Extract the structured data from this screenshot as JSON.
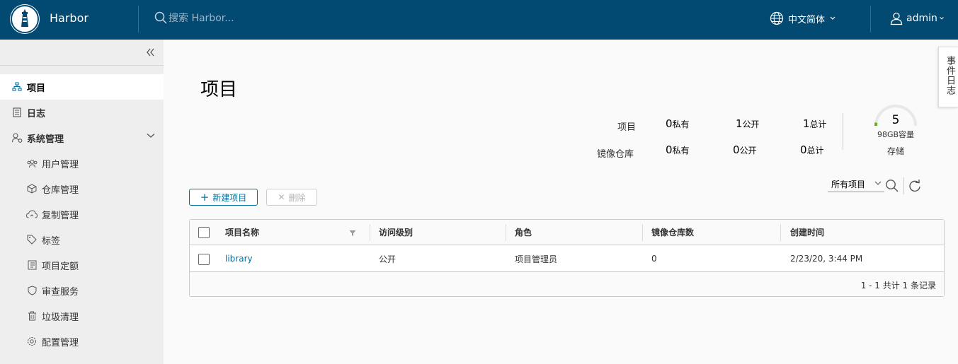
{
  "header": {
    "brand": "Harbor",
    "search_placeholder": "搜索 Harbor...",
    "language": "中文简体",
    "user": "admin",
    "bg_color": "#034a73"
  },
  "sidebar": {
    "items": [
      {
        "label": "项目",
        "icon": "project-icon"
      },
      {
        "label": "日志",
        "icon": "log-icon"
      },
      {
        "label": "系统管理",
        "icon": "admin-icon"
      },
      {
        "label": "用户管理",
        "icon": "users-icon"
      },
      {
        "label": "仓库管理",
        "icon": "box-icon"
      },
      {
        "label": "复制管理",
        "icon": "cloud-sync-icon"
      },
      {
        "label": "标签",
        "icon": "tag-icon"
      },
      {
        "label": "项目定额",
        "icon": "quota-icon"
      },
      {
        "label": "审查服务",
        "icon": "shield-icon"
      },
      {
        "label": "垃圾清理",
        "icon": "trash-icon"
      },
      {
        "label": "配置管理",
        "icon": "gear-icon"
      }
    ]
  },
  "main": {
    "title": "项目",
    "stats": {
      "projects_label": "项目",
      "repos_label": "镜像仓库",
      "private_label": "私有",
      "public_label": "公开",
      "total_label": "总计",
      "projects": {
        "private": "0",
        "public": "1",
        "total": "1"
      },
      "repos": {
        "private": "0",
        "public": "0",
        "total": "0"
      }
    },
    "storage": {
      "value": "5",
      "capacity": "98GB容量",
      "label": "存储",
      "used_fraction": 0.05
    }
  },
  "event_log_tab": "事件日志",
  "toolbar": {
    "new_project": "新建项目",
    "delete": "删除",
    "filter_selected": "所有项目"
  },
  "table": {
    "columns": [
      "项目名称",
      "访问级别",
      "角色",
      "镜像仓库数",
      "创建时间"
    ],
    "rows": [
      {
        "name": "library",
        "access": "公开",
        "role": "项目管理员",
        "repo_count": "0",
        "created": "2/23/20, 3:44 PM"
      }
    ],
    "footer": "1 - 1 共计 1 条记录"
  }
}
